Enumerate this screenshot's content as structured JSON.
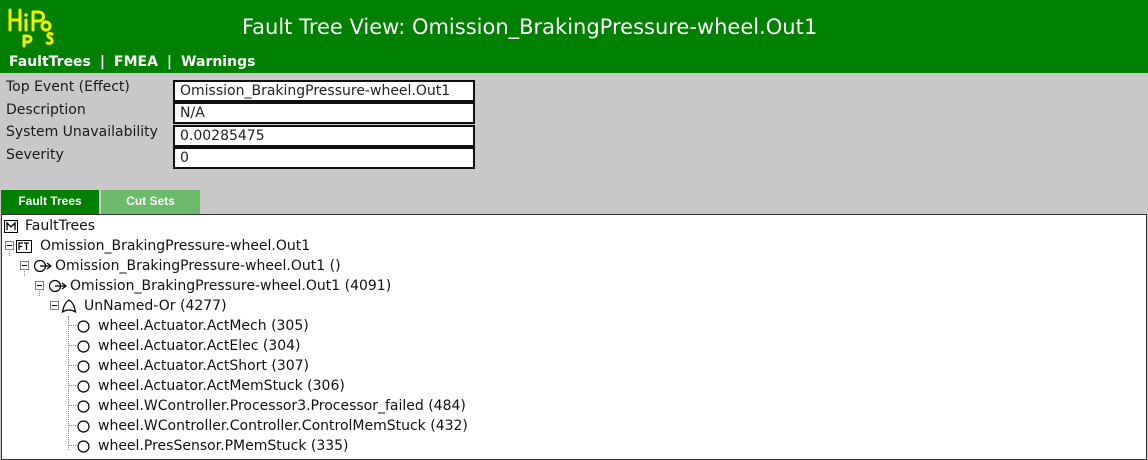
{
  "header": {
    "title": "Fault Tree View: Omission_BrakingPressure-wheel.Out1",
    "logo_letters": [
      "H",
      "i",
      "P",
      "o",
      "p",
      "s"
    ]
  },
  "nav": {
    "items": [
      "FaultTrees",
      "FMEA",
      "Warnings"
    ],
    "separator": "|"
  },
  "properties": [
    {
      "label": "Top Event (Effect)",
      "value": "Omission_BrakingPressure-wheel.Out1"
    },
    {
      "label": "Description",
      "value": "N/A"
    },
    {
      "label": "System Unavailability",
      "value": "0.00285475"
    },
    {
      "label": "Severity",
      "value": "0"
    }
  ],
  "tabs": [
    {
      "label": "Fault Trees",
      "active": true
    },
    {
      "label": "Cut Sets",
      "active": false
    }
  ],
  "tree": {
    "root": {
      "label": "FaultTrees",
      "icon": "fault-trees-root-icon"
    },
    "nodes": [
      {
        "label": "Omission_BrakingPressure-wheel.Out1",
        "icon": "fault-tree-icon"
      },
      {
        "label": "Omission_BrakingPressure-wheel.Out1 ()",
        "icon": "top-event-icon"
      },
      {
        "label": "Omission_BrakingPressure-wheel.Out1 (4091)",
        "icon": "output-deviation-icon"
      },
      {
        "label": "UnNamed-Or (4277)",
        "icon": "or-gate-icon"
      }
    ],
    "leaves": [
      "wheel.Actuator.ActMech (305)",
      "wheel.Actuator.ActElec (304)",
      "wheel.Actuator.ActShort (307)",
      "wheel.Actuator.ActMemStuck (306)",
      "wheel.WController.Processor3.Processor_failed (484)",
      "wheel.WController.Controller.ControlMemStuck (432)",
      "wheel.PresSensor.PMemStuck (335)"
    ]
  },
  "colors": {
    "header_green": "#008000",
    "tab_inactive_green": "#6cbb6c",
    "logo_yellow": "#f0f000",
    "panel_gray": "#c8c8c8"
  }
}
